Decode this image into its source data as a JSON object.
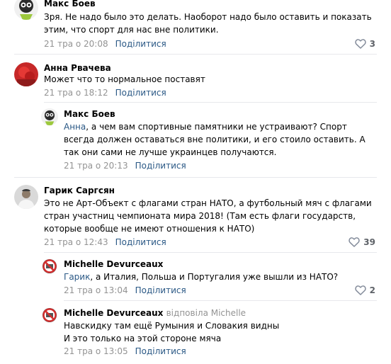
{
  "comments": [
    {
      "author": "Макс Боев",
      "text": "Зря. Не надо было это делать. Наоборот надо было оставить и показать этим, что спорт для нас вне политики.",
      "time": "21 тра о 20:08",
      "reply_label": "Поділитися",
      "likes": "3",
      "avatar_icon": "cartoon-character-avatar"
    },
    {
      "author": "Анна Рвачева",
      "text": "Может что то нормальное поставят",
      "time": "21 тра о 18:12",
      "reply_label": "Поділитися",
      "avatar_icon": "red-photo-avatar"
    },
    {
      "author": "Макс Боев",
      "mention": "Анна",
      "text": ", а чем вам спортивные памятники не устраивают? Спорт всегда должен оставаться вне политики, и его стоило оставить. А так они сами не лучше украинцев получаются.",
      "time": "21 тра о 20:13",
      "reply_label": "Поділитися",
      "avatar_icon": "cartoon-character-avatar"
    },
    {
      "author": "Гарик Саргсян",
      "text": "Это не Арт-Объект с флагами стран НАТО, а футбольный мяч с флагами стран участниц чемпионата мира 2018! (Там есть флаги государств, которые вообще не имеют отношения к НАТО)",
      "time": "21 тра о 12:43",
      "reply_label": "Поділитися",
      "likes": "39",
      "avatar_icon": "person-photo-avatar"
    },
    {
      "author": "Michelle Devurceaux",
      "mention": "Гарик",
      "text": ", а Италия, Польша и Португалия уже вышли из НАТО?",
      "time": "21 тра о 13:04",
      "reply_label": "Поділитися",
      "likes": "2",
      "avatar_icon": "no-symbol-avatar"
    },
    {
      "author": "Michelle Devurceaux",
      "replied_to": "відповіла Michelle",
      "text_lines": [
        "Навскидку там ещё Румыния и Словакия видны",
        "И это только на этой стороне мяча"
      ],
      "time": "21 тра о 13:05",
      "reply_label": "Поділитися",
      "avatar_icon": "no-symbol-avatar"
    }
  ],
  "colors": {
    "link": "#2a5885",
    "meta": "#939393",
    "divider": "#e7e8ec",
    "like_icon": "#828a99"
  },
  "icons": {
    "like": "heart-outline-icon"
  }
}
